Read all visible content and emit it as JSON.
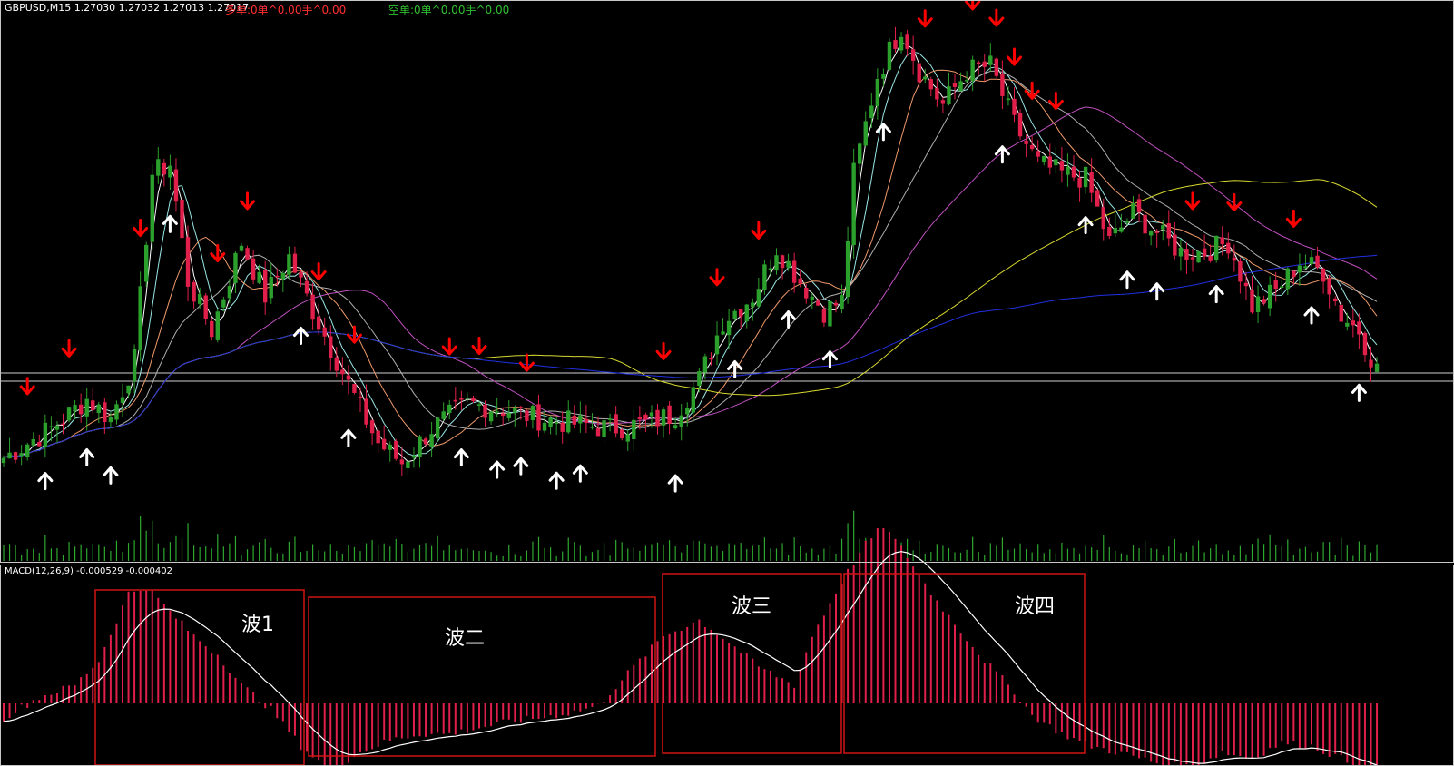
{
  "header": {
    "symbol_text": "GBPUSD,M15  1.27030 1.27032 1.27013 1.27017",
    "long_text": "多单:0单^0.00手^0.00",
    "short_text": "空单:0单^0.00手^0.00"
  },
  "macd_header": "MACD(12,26,9) -0.000529 -0.000402",
  "wave_labels": [
    "波1",
    "波二",
    "波三",
    "波四"
  ],
  "colors": {
    "background": "#000000",
    "bull_candle": "#2ca02c",
    "bear_candle": "#e0204a",
    "down_arrow": "#ff0000",
    "up_arrow": "#ffffff",
    "volume": "#2ea82e",
    "macd_hist": "#e0204a",
    "macd_signal": "#ffffff",
    "frame": "#c8c8c8",
    "wave_box": "#d01414",
    "long_text": "#ff3030",
    "short_text": "#30c030"
  },
  "chart_data": {
    "type": "candlestick",
    "symbol": "GBPUSD",
    "timeframe": "M15",
    "last_ohlc": [
      1.2703,
      1.27032,
      1.27013,
      1.27017
    ],
    "macd": {
      "params": [
        12,
        26,
        9
      ],
      "main": -0.000529,
      "signal": -0.000402
    },
    "price_waypoints": [
      [
        0,
        0.14
      ],
      [
        8,
        0.2
      ],
      [
        14,
        0.26
      ],
      [
        18,
        0.22
      ],
      [
        22,
        0.34
      ],
      [
        25,
        0.72
      ],
      [
        28,
        0.74
      ],
      [
        31,
        0.5
      ],
      [
        35,
        0.4
      ],
      [
        40,
        0.58
      ],
      [
        44,
        0.47
      ],
      [
        48,
        0.55
      ],
      [
        52,
        0.44
      ],
      [
        56,
        0.34
      ],
      [
        60,
        0.24
      ],
      [
        63,
        0.17
      ],
      [
        67,
        0.13
      ],
      [
        72,
        0.2
      ],
      [
        78,
        0.25
      ],
      [
        84,
        0.24
      ],
      [
        90,
        0.22
      ],
      [
        96,
        0.21
      ],
      [
        102,
        0.2
      ],
      [
        108,
        0.21
      ],
      [
        113,
        0.23
      ],
      [
        117,
        0.3
      ],
      [
        121,
        0.42
      ],
      [
        126,
        0.47
      ],
      [
        130,
        0.57
      ],
      [
        134,
        0.5
      ],
      [
        138,
        0.44
      ],
      [
        141,
        0.46
      ],
      [
        143,
        0.72
      ],
      [
        147,
        0.92
      ],
      [
        151,
        1.02
      ],
      [
        154,
        0.93
      ],
      [
        158,
        0.86
      ],
      [
        162,
        0.93
      ],
      [
        166,
        0.94
      ],
      [
        170,
        0.82
      ],
      [
        174,
        0.74
      ],
      [
        178,
        0.72
      ],
      [
        182,
        0.71
      ],
      [
        186,
        0.58
      ],
      [
        190,
        0.64
      ],
      [
        194,
        0.6
      ],
      [
        198,
        0.56
      ],
      [
        202,
        0.56
      ],
      [
        206,
        0.58
      ],
      [
        210,
        0.45
      ],
      [
        214,
        0.48
      ],
      [
        218,
        0.54
      ],
      [
        222,
        0.52
      ],
      [
        225,
        0.43
      ],
      [
        228,
        0.4
      ],
      [
        231,
        0.32
      ]
    ],
    "macd_hist_waypoints": [
      [
        0,
        -0.12
      ],
      [
        6,
        0.05
      ],
      [
        12,
        0.15
      ],
      [
        16,
        0.35
      ],
      [
        21,
        0.9
      ],
      [
        24,
        0.95
      ],
      [
        28,
        0.75
      ],
      [
        32,
        0.55
      ],
      [
        36,
        0.4
      ],
      [
        40,
        0.15
      ],
      [
        45,
        -0.05
      ],
      [
        50,
        -0.35
      ],
      [
        55,
        -0.55
      ],
      [
        60,
        -0.4
      ],
      [
        65,
        -0.3
      ],
      [
        70,
        -0.25
      ],
      [
        75,
        -0.25
      ],
      [
        80,
        -0.2
      ],
      [
        85,
        -0.15
      ],
      [
        90,
        -0.12
      ],
      [
        95,
        -0.08
      ],
      [
        100,
        -0.02
      ],
      [
        106,
        0.3
      ],
      [
        111,
        0.55
      ],
      [
        117,
        0.68
      ],
      [
        122,
        0.5
      ],
      [
        127,
        0.3
      ],
      [
        133,
        0.15
      ],
      [
        136,
        0.55
      ],
      [
        141,
        1.0
      ],
      [
        145,
        1.3
      ],
      [
        148,
        1.45
      ],
      [
        152,
        1.2
      ],
      [
        156,
        0.9
      ],
      [
        160,
        0.65
      ],
      [
        165,
        0.35
      ],
      [
        170,
        0.1
      ],
      [
        173,
        -0.1
      ],
      [
        178,
        -0.25
      ],
      [
        183,
        -0.35
      ],
      [
        189,
        -0.42
      ],
      [
        195,
        -0.5
      ],
      [
        200,
        -0.52
      ],
      [
        205,
        -0.4
      ],
      [
        210,
        -0.45
      ],
      [
        215,
        -0.32
      ],
      [
        220,
        -0.35
      ],
      [
        225,
        -0.45
      ],
      [
        231,
        -0.6
      ]
    ],
    "down_arrow_bars": [
      4,
      11,
      23,
      36,
      41,
      53,
      59,
      75,
      80,
      88,
      111,
      120,
      127,
      152,
      155,
      163,
      167,
      170,
      173,
      177,
      200,
      207,
      217
    ],
    "up_arrow_bars": [
      7,
      14,
      18,
      28,
      50,
      58,
      77,
      83,
      87,
      93,
      97,
      113,
      123,
      132,
      139,
      148,
      168,
      182,
      189,
      194,
      204,
      220,
      228
    ],
    "wave_boxes": [
      "波1",
      "波二",
      "波三",
      "波四"
    ]
  }
}
